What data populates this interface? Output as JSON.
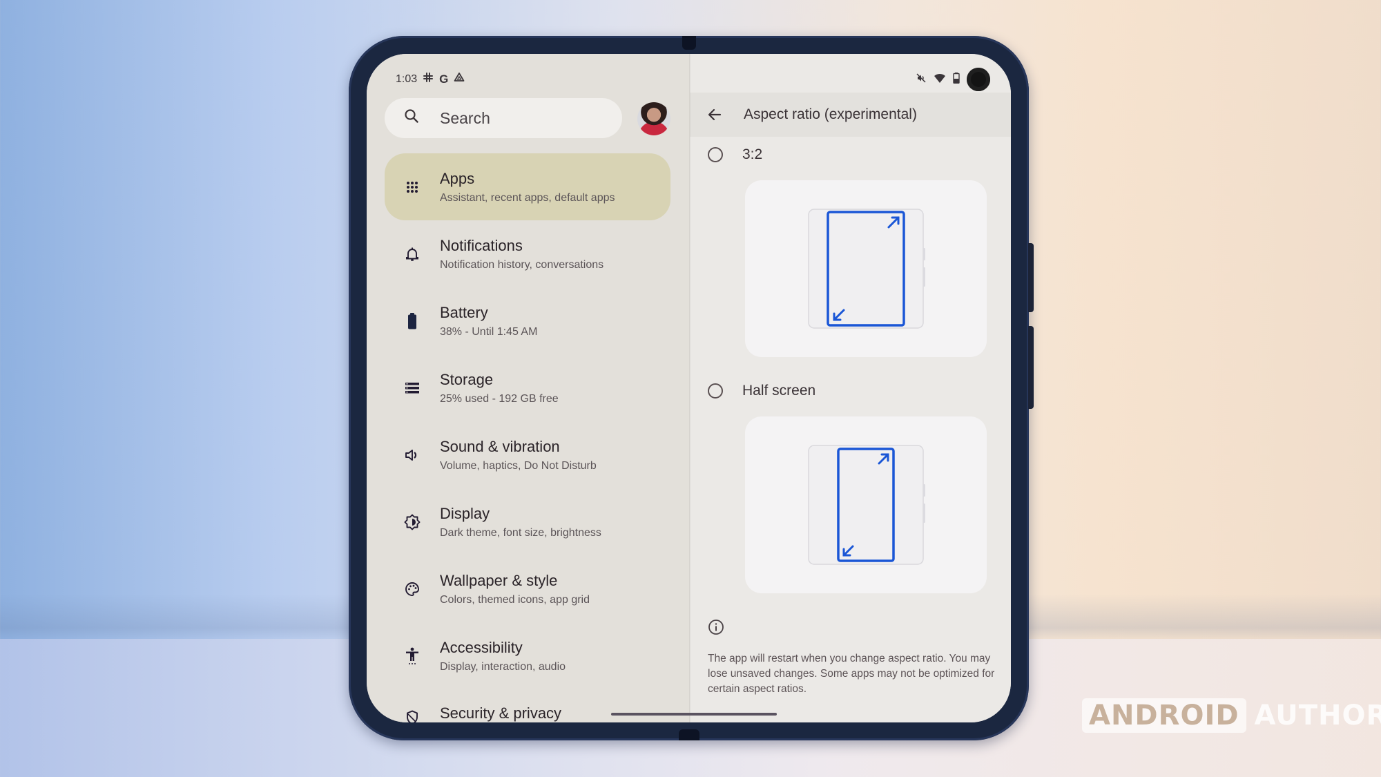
{
  "status_bar": {
    "time": "1:03",
    "left_icons": [
      "slack-icon",
      "google-icon",
      "drive-icon"
    ],
    "google_glyph": "G",
    "right_icons": [
      "vibrate-off-icon",
      "wifi-icon",
      "battery-icon"
    ]
  },
  "search": {
    "placeholder": "Search"
  },
  "settings": {
    "items": [
      {
        "title": "Apps",
        "subtitle": "Assistant, recent apps, default apps",
        "icon": "apps-grid-icon",
        "active": true
      },
      {
        "title": "Notifications",
        "subtitle": "Notification history, conversations",
        "icon": "bell-icon"
      },
      {
        "title": "Battery",
        "subtitle": "38% - Until 1:45 AM",
        "icon": "battery-icon"
      },
      {
        "title": "Storage",
        "subtitle": "25% used - 192 GB free",
        "icon": "storage-icon"
      },
      {
        "title": "Sound & vibration",
        "subtitle": "Volume, haptics, Do Not Disturb",
        "icon": "volume-icon"
      },
      {
        "title": "Display",
        "subtitle": "Dark theme, font size, brightness",
        "icon": "brightness-icon"
      },
      {
        "title": "Wallpaper & style",
        "subtitle": "Colors, themed icons, app grid",
        "icon": "palette-icon"
      },
      {
        "title": "Accessibility",
        "subtitle": "Display, interaction, audio",
        "icon": "accessibility-icon"
      },
      {
        "title": "Security & privacy",
        "subtitle": "",
        "icon": "shield-icon"
      }
    ]
  },
  "detail": {
    "title": "Aspect ratio (experimental)",
    "options": [
      {
        "label": "3:2",
        "selected": false
      },
      {
        "label": "Half screen",
        "selected": false
      }
    ],
    "info_text": "The app will restart when you change aspect ratio. You may lose unsaved changes. Some apps may not be optimized for certain aspect ratios."
  },
  "colors": {
    "accent_blue": "#1a56d6",
    "active_item_bg": "#d8d3b4",
    "device_frame": "#1b2740"
  },
  "watermark": {
    "boxed": "ANDROID",
    "plain": "AUTHORITY"
  }
}
